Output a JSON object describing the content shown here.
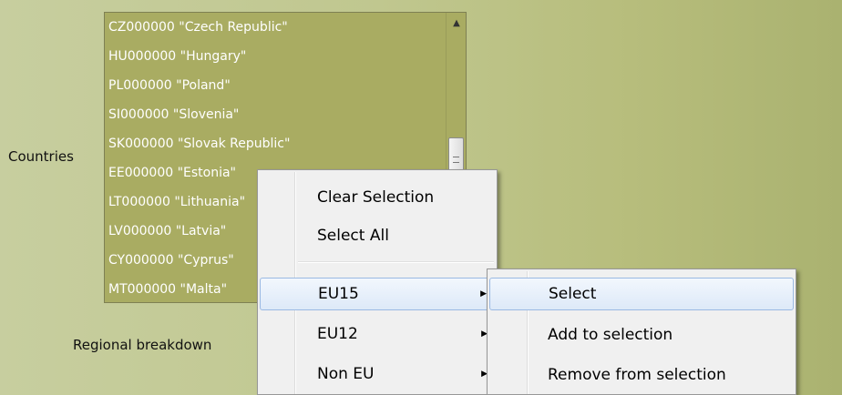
{
  "form": {
    "countries_label": "Countries",
    "regional_label": "Regional breakdown"
  },
  "countries_list": {
    "items": [
      "CZ000000 \"Czech Republic\"",
      "HU000000 \"Hungary\"",
      "PL000000 \"Poland\"",
      "SI000000 \"Slovenia\"",
      "SK000000 \"Slovak Republic\"",
      "EE000000 \"Estonia\"",
      "LT000000 \"Lithuania\"",
      "LV000000 \"Latvia\"",
      "CY000000  \"Cyprus\"",
      "MT000000  \"Malta\""
    ],
    "scroll_up_glyph": "▲"
  },
  "context_menu": {
    "items": [
      "Clear Selection",
      "Select All",
      "EU15",
      "EU12",
      "Non EU"
    ],
    "submenu_arrow_glyph": "▶"
  },
  "submenu": {
    "items": [
      "Select",
      "Add to selection",
      "Remove from selection"
    ]
  },
  "colors": {
    "list_background": "#a9ac62",
    "highlight_border": "#9ab9e3",
    "menu_background": "#f0f0f0"
  }
}
